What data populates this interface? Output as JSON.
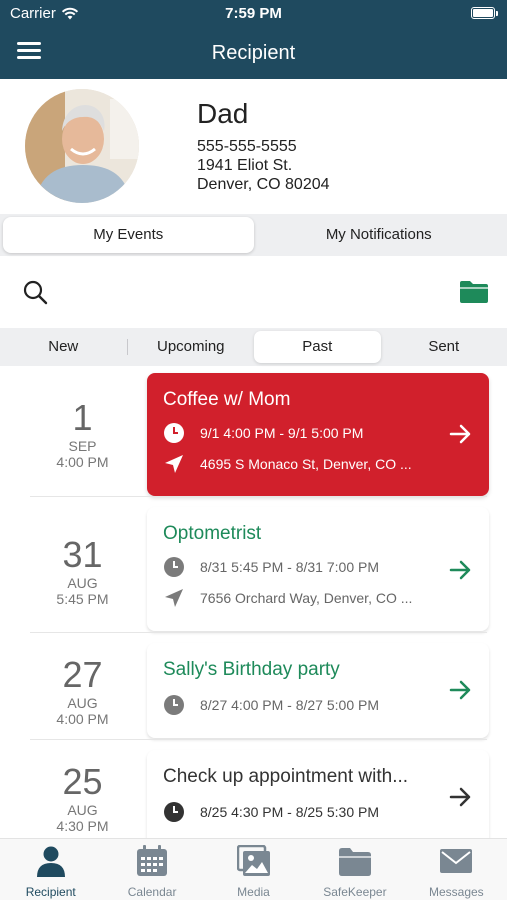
{
  "status_bar": {
    "carrier": "Carrier",
    "time": "7:59 PM"
  },
  "header": {
    "title": "Recipient",
    "menu_icon": "hamburger-menu-icon"
  },
  "profile": {
    "name": "Dad",
    "phone": "555-555-5555",
    "street": "1941 Eliot St.",
    "city_line": "Denver, CO  80204"
  },
  "main_tabs": [
    {
      "label": "My Events",
      "active": true
    },
    {
      "label": "My Notifications",
      "active": false
    }
  ],
  "filter_tabs": [
    {
      "label": "New",
      "active": false
    },
    {
      "label": "Upcoming",
      "active": false
    },
    {
      "label": "Past",
      "active": true
    },
    {
      "label": "Sent",
      "active": false
    }
  ],
  "events": [
    {
      "day": "1",
      "month": "SEP",
      "time": "4:00 PM",
      "title": "Coffee w/ Mom",
      "when": "9/1 4:00 PM - 9/1 5:00 PM",
      "where": "4695 S Monaco St, Denver, CO ...",
      "style": "red"
    },
    {
      "day": "31",
      "month": "AUG",
      "time": "5:45 PM",
      "title": "Optometrist",
      "when": "8/31 5:45 PM - 8/31 7:00 PM",
      "where": "7656 Orchard Way, Denver, CO ...",
      "style": "green"
    },
    {
      "day": "27",
      "month": "AUG",
      "time": "4:00 PM",
      "title": "Sally's Birthday party",
      "when": "8/27 4:00 PM - 8/27 5:00 PM",
      "where": "",
      "style": "green"
    },
    {
      "day": "25",
      "month": "AUG",
      "time": "4:30 PM",
      "title": "Check up appointment with...",
      "when": "8/25 4:30 PM - 8/25 5:30 PM",
      "where": "",
      "style": "dark"
    }
  ],
  "tab_bar": [
    {
      "label": "Recipient",
      "icon": "person-icon",
      "active": true
    },
    {
      "label": "Calendar",
      "icon": "calendar-icon",
      "active": false
    },
    {
      "label": "Media",
      "icon": "photos-icon",
      "active": false
    },
    {
      "label": "SafeKeeper",
      "icon": "folder-icon",
      "active": false
    },
    {
      "label": "Messages",
      "icon": "envelope-icon",
      "active": false
    }
  ],
  "colors": {
    "header": "#1f4a5f",
    "accent_red": "#d1202c",
    "accent_green": "#1e8a5a",
    "folder_green": "#1e8a5a",
    "tab_active": "#1f4a5f",
    "tab_inactive": "#7a8792"
  }
}
